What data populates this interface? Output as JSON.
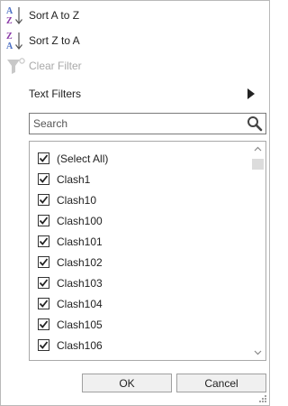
{
  "menu": {
    "sort_az": "Sort A to Z",
    "sort_za": "Sort Z to A",
    "clear_filter": "Clear Filter",
    "text_filters": "Text Filters"
  },
  "search": {
    "placeholder": "Search",
    "value": ""
  },
  "list": {
    "items": [
      {
        "label": "(Select All)",
        "checked": true
      },
      {
        "label": "Clash1",
        "checked": true
      },
      {
        "label": "Clash10",
        "checked": true
      },
      {
        "label": "Clash100",
        "checked": true
      },
      {
        "label": "Clash101",
        "checked": true
      },
      {
        "label": "Clash102",
        "checked": true
      },
      {
        "label": "Clash103",
        "checked": true
      },
      {
        "label": "Clash104",
        "checked": true
      },
      {
        "label": "Clash105",
        "checked": true
      },
      {
        "label": "Clash106",
        "checked": true
      }
    ]
  },
  "buttons": {
    "ok": "OK",
    "cancel": "Cancel"
  },
  "icons": {
    "sort_az": "sort-ascending-icon",
    "sort_za": "sort-descending-icon",
    "clear_filter": "clear-filter-icon",
    "submenu": "chevron-right-icon",
    "search": "search-icon"
  },
  "colors": {
    "sort_letter_blue": "#4b6fc4",
    "sort_letter_purple": "#8a3aa8",
    "disabled_text": "#a9a9a9",
    "button_bg": "#f0f0f0"
  }
}
